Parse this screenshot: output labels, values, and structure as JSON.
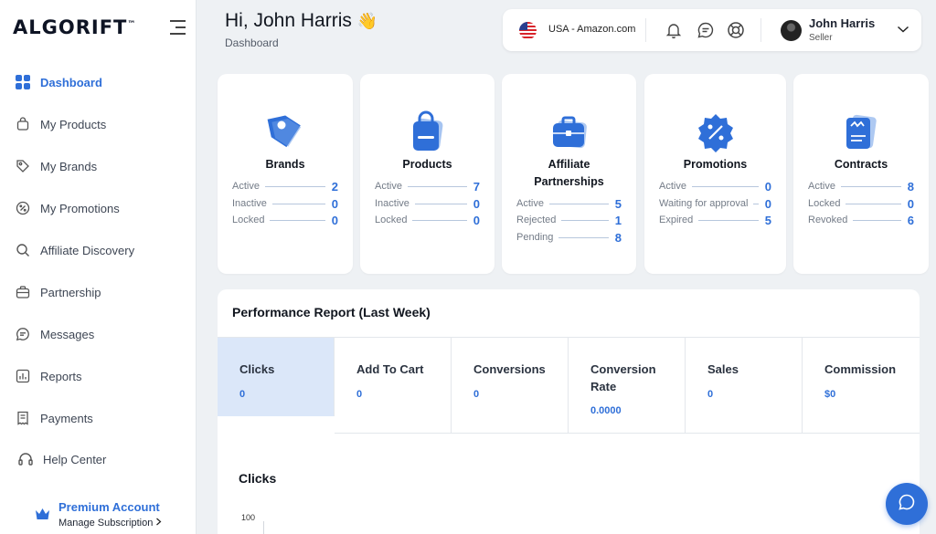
{
  "logo": {
    "text": "ALGORIFT",
    "tm": "™"
  },
  "sidebar": {
    "items": [
      {
        "label": "Dashboard",
        "icon": "grid-icon"
      },
      {
        "label": "My Products",
        "icon": "bag-icon"
      },
      {
        "label": "My Brands",
        "icon": "tag-icon"
      },
      {
        "label": "My Promotions",
        "icon": "percent-badge-icon"
      },
      {
        "label": "Affiliate Discovery",
        "icon": "search-icon"
      },
      {
        "label": "Partnership",
        "icon": "briefcase-icon"
      },
      {
        "label": "Messages",
        "icon": "chat-icon"
      },
      {
        "label": "Reports",
        "icon": "bar-chart-icon"
      },
      {
        "label": "Payments",
        "icon": "invoice-icon"
      },
      {
        "label": "Help Center",
        "icon": "headset-icon"
      }
    ],
    "premium": {
      "title": "Premium Account",
      "subtitle": "Manage Subscription"
    }
  },
  "header": {
    "greeting": "Hi, John Harris",
    "wave": "👋",
    "breadcrumb": "Dashboard",
    "marketplace": "USA - Amazon.com",
    "user_name": "John Harris",
    "user_role": "Seller"
  },
  "cards": [
    {
      "title": "Brands",
      "stats": [
        {
          "label": "Active",
          "value": "2"
        },
        {
          "label": "Inactive",
          "value": "0"
        },
        {
          "label": "Locked",
          "value": "0"
        }
      ]
    },
    {
      "title": "Products",
      "stats": [
        {
          "label": "Active",
          "value": "7"
        },
        {
          "label": "Inactive",
          "value": "0"
        },
        {
          "label": "Locked",
          "value": "0"
        }
      ]
    },
    {
      "title": "Affiliate Partnerships",
      "stats": [
        {
          "label": "Active",
          "value": "5"
        },
        {
          "label": "Rejected",
          "value": "1"
        },
        {
          "label": "Pending",
          "value": "8"
        }
      ]
    },
    {
      "title": "Promotions",
      "stats": [
        {
          "label": "Active",
          "value": "0"
        },
        {
          "label": "Waiting for approval",
          "value": "0"
        },
        {
          "label": "Expired",
          "value": "5"
        }
      ]
    },
    {
      "title": "Contracts",
      "stats": [
        {
          "label": "Active",
          "value": "8"
        },
        {
          "label": "Locked",
          "value": "0"
        },
        {
          "label": "Revoked",
          "value": "6"
        }
      ]
    }
  ],
  "performance": {
    "title": "Performance Report (Last Week)",
    "metrics": [
      {
        "label": "Clicks",
        "value": "0"
      },
      {
        "label": "Add To Cart",
        "value": "0"
      },
      {
        "label": "Conversions",
        "value": "0"
      },
      {
        "label": "Conversion Rate",
        "value": "0.0000"
      },
      {
        "label": "Sales",
        "value": "0"
      },
      {
        "label": "Commission",
        "value": "$0"
      }
    ],
    "chart_title": "Clicks",
    "y_top_tick": "100"
  },
  "colors": {
    "accent": "#2f6fd8",
    "selected_bg": "#dbe7f9",
    "page_bg": "#eef1f4"
  }
}
